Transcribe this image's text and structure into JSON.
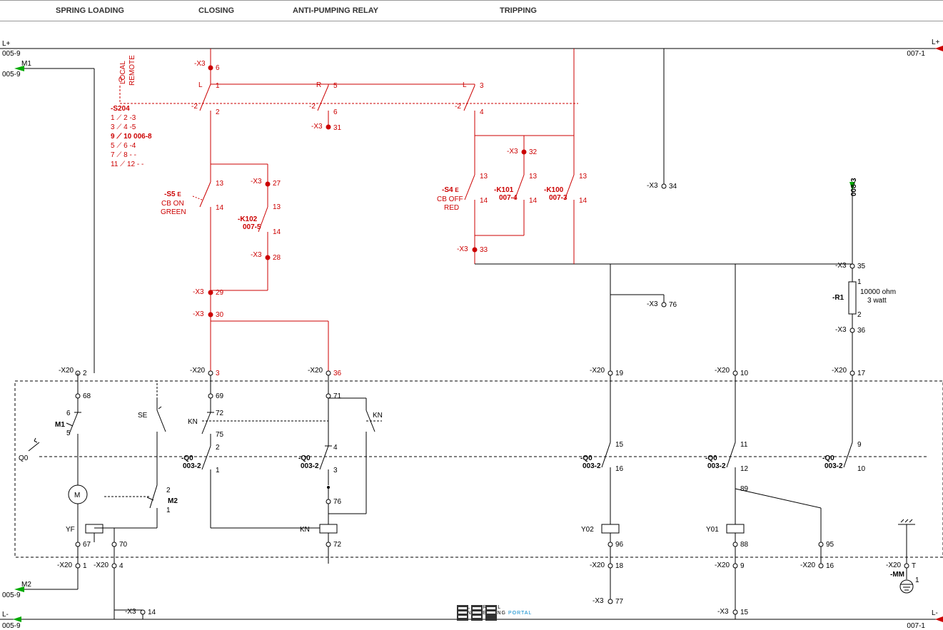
{
  "header": {
    "c1": "SPRING LOADING",
    "c2": "CLOSING",
    "c3": "ANTI-PUMPING RELAY",
    "c4": "TRIPPING"
  },
  "rails": {
    "l_plus_left": "L+",
    "l_plus_right": "L+",
    "l_minus_left": "L-",
    "l_minus_right": "L-",
    "m1": "M1",
    "m2": "M2",
    "ref_left_1": "005-9",
    "ref_left_2": "005-9",
    "ref_left_3": "005-9",
    "ref_left_4": "005-9",
    "ref_left_5": "005-9",
    "ref_right_1": "007-1",
    "ref_right_2": "007-1",
    "ref_v": "008-3"
  },
  "s204": {
    "name": "-S204",
    "pos0": "0",
    "pos1": "LOCAL",
    "pos2": "REMOTE",
    "rows": [
      "1 ⟋ 2   -3",
      "3 ⟋ 4   -5",
      "9 ⟋ 10  006-8",
      "5 ⟋ 6   -4",
      "7 ⟋ 8   - -",
      "11 ⟋ 12  - -"
    ],
    "cL": "L",
    "c5": "5",
    "cR": "R",
    "c3": "3",
    "neg2": "-2"
  },
  "x3": {
    "t6": "6",
    "t1": "1",
    "t2": "2",
    "t5": "5",
    "t6b": "6",
    "t3": "3",
    "t4": "4",
    "t31": "31",
    "t27": "27",
    "t28": "28",
    "t29": "29",
    "t30": "30",
    "t32": "32",
    "t33": "33",
    "t34": "34",
    "t35": "35",
    "t36": "36",
    "t76": "76",
    "t77": "77",
    "t14": "14",
    "t15": "15",
    "lbl": "-X3"
  },
  "s5": {
    "name": "-S5",
    "sub": "CB ON\nGREEN",
    "e": "E",
    "t13": "13",
    "t14": "14"
  },
  "k102": {
    "name": "-K102",
    "ref": "007-5",
    "t13": "13",
    "t14": "14"
  },
  "s4": {
    "name": "-S4",
    "sub": "CB OFF\nRED",
    "e": "E",
    "t13": "13",
    "t14": "14"
  },
  "k101": {
    "name": "-K101",
    "ref": "007-4",
    "t13": "13",
    "t14": "14"
  },
  "k100": {
    "name": "-K100",
    "ref": "007-3",
    "t13": "13",
    "t14": "14"
  },
  "r1": {
    "name": "-R1",
    "val": "10000 ohm",
    "watt": "3 watt",
    "t1": "1",
    "t2": "2"
  },
  "x20": {
    "lbl": "-X20",
    "t1": "1",
    "t2": "2",
    "t3": "3",
    "t4": "4",
    "t36": "36",
    "t19": "19",
    "t10": "10",
    "t17": "17",
    "t18": "18",
    "t9": "9",
    "t16": "16",
    "tT": "T"
  },
  "q0": {
    "name": "Q0",
    "neg": "-Q0",
    "ref": "003-2"
  },
  "m": {
    "motor": "M",
    "m1": "M1",
    "m2": "M2",
    "yf": "YF",
    "kn": "KN",
    "se": "SE",
    "y01": "Y01",
    "y02": "Y02",
    "mm": "-MM"
  },
  "nodes": {
    "n68": "68",
    "n69": "69",
    "n71": "71",
    "n67": "67",
    "n70": "70",
    "n72": "72",
    "n75": "75",
    "n76": "76",
    "n88": "88",
    "n89": "89",
    "n95": "95",
    "n96": "96",
    "c1": "1",
    "c2": "2",
    "c3": "3",
    "c4": "4",
    "c5": "5",
    "c6": "6",
    "c9": "9",
    "c10": "10",
    "c11": "11",
    "c12": "12",
    "c15": "15",
    "c16": "16"
  },
  "logo": {
    "l1": "ELECTRICAL",
    "l2": "ENGINEERING",
    "l3": "PORTAL"
  }
}
